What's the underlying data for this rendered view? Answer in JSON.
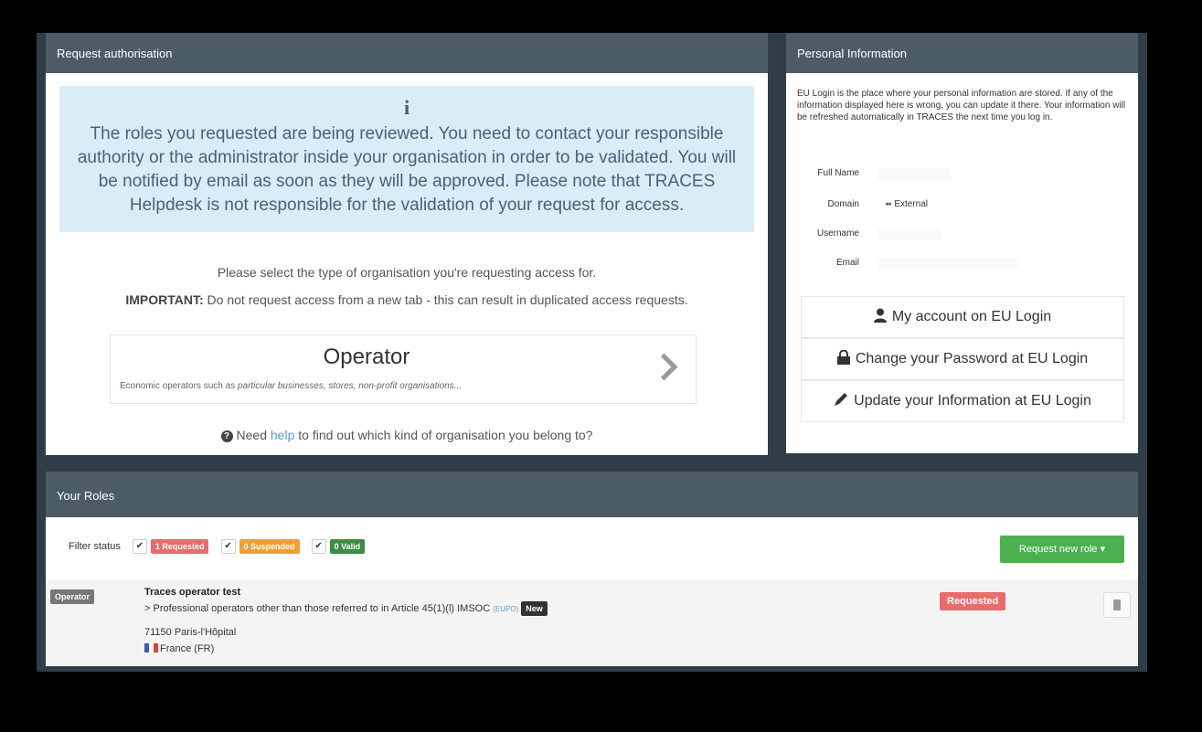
{
  "request_panel": {
    "title": "Request authorisation",
    "info_icon": "i",
    "info_text": "The roles you requested are being reviewed. You need to contact your responsible authority or the administrator inside your organisation in order to be validated. You will be notified by email as soon as they will be approved. Please note that TRACES Helpdesk is not responsible for the validation of your request for access.",
    "select_prompt": "Please select the type of organisation you're requesting access for.",
    "important_label": "IMPORTANT:",
    "important_text": " Do not request access from a new tab - this can result in duplicated access requests.",
    "operator_card": {
      "title": "Operator",
      "desc_prefix": "Economic operators such as ",
      "desc_italic": "particular businesses, stores, non-profit organisations...",
      "icon": "chevron-right-icon"
    },
    "help_prefix": "Need ",
    "help_link": "help",
    "help_suffix": " to find out which kind of organisation you belong to?"
  },
  "personal_info": {
    "title": "Personal Information",
    "text": "EU Login is the place where your personal information are stored. If any of the information displayed here is wrong, you can update it there. Your information will be refreshed automatically in TRACES the next time you log in.",
    "full_name_label": "Full Name",
    "domain_label": "Domain",
    "domain_value": "External",
    "username_label": "Username",
    "email_label": "Email",
    "btn_account": "My account on EU Login",
    "btn_password": "Change your Password at EU Login",
    "btn_update": "Update your Information at EU Login"
  },
  "roles": {
    "title": "Your Roles",
    "filter_label": "Filter status",
    "badge_requested": "1 Requested",
    "badge_suspended": "0 Suspended",
    "badge_valid": "0 Valid",
    "request_new_role": "Request new role ▾",
    "row": {
      "type": "Operator",
      "name": "Traces operator test",
      "activity": "Professional operators other than those referred to in Article 45(1)(l) IMSOC",
      "eupo": "(EUPO)",
      "new_badge": "New",
      "address": "71150 Paris-l'Hôpital",
      "country": "France (FR)",
      "status": "Requested"
    }
  },
  "colors": {
    "header": "#4b5c67",
    "info_bg": "#d9edf7",
    "requested": "#e86c6c",
    "suspended": "#f0a030",
    "valid": "#3c8c44",
    "primary_green": "#4cb050"
  }
}
